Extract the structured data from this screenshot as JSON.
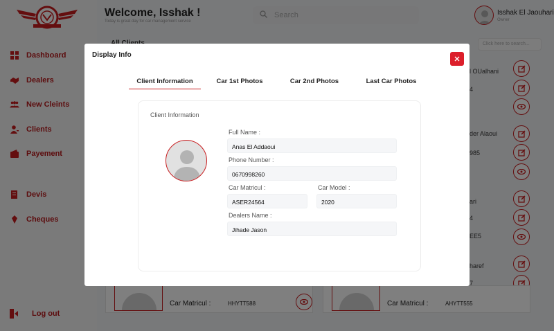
{
  "header": {
    "welcome": "Welcome, Isshak !",
    "subtitle": "Today is great day for car management service",
    "search_placeholder": "Search",
    "user_name": "Isshak El Jaouhari",
    "user_role": "Owner"
  },
  "sidebar": {
    "items": [
      {
        "label": "Dashboard",
        "icon": "grid-icon"
      },
      {
        "label": "Dealers",
        "icon": "handshake-icon"
      },
      {
        "label": "New Cleints",
        "icon": "users-icon"
      },
      {
        "label": "Clients",
        "icon": "user-icon"
      },
      {
        "label": "Payement",
        "icon": "wallet-icon"
      },
      {
        "label": "Devis",
        "icon": "document-icon"
      },
      {
        "label": "Cheques",
        "icon": "cheque-icon"
      }
    ],
    "logout": "Log out"
  },
  "content": {
    "title": "All Clients",
    "search_placeholder": "Click here to search...",
    "right_texts": [
      "l OUalhani",
      "4",
      "der Alaoui",
      "985",
      "ari",
      "4",
      "EE5",
      "haref",
      "7"
    ],
    "cards": [
      {
        "label": "Car Matricul :",
        "value": "HHYTT588"
      },
      {
        "label": "Car Matricul :",
        "value": "AHYTT555"
      }
    ]
  },
  "modal": {
    "title": "Display Info",
    "close_symbol": "×",
    "tabs": [
      {
        "label": "Client Information",
        "active": true
      },
      {
        "label": "Car 1st Photos",
        "active": false
      },
      {
        "label": "Car 2nd Photos",
        "active": false
      },
      {
        "label": "Last Car Photos",
        "active": false
      }
    ],
    "panel": {
      "title": "Client Information",
      "full_name_label": "Full Name :",
      "full_name": "Anas El Addaoui",
      "phone_label": "Phone Number :",
      "phone": "0670998260",
      "matricul_label": "Car Matricul :",
      "matricul": "ASER24564",
      "model_label": "Car Model :",
      "model": "2020",
      "dealer_label": "Dealers Name :",
      "dealer": "Jihade Jason"
    }
  },
  "colors": {
    "accent": "#c81d1f",
    "close_button": "#dc1f2b",
    "field_background": "#f5f6f8"
  }
}
